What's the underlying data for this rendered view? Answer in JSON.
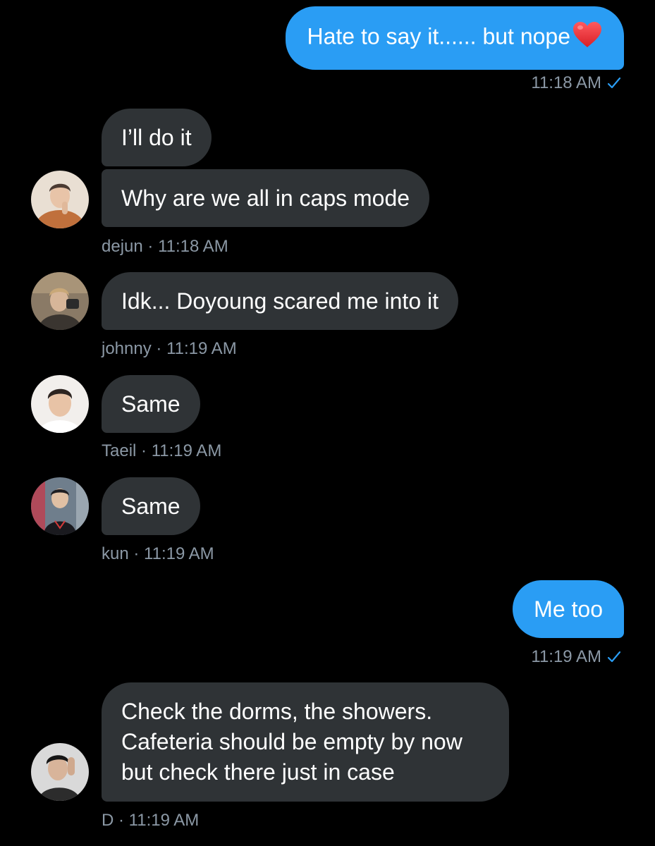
{
  "colors": {
    "background": "#000000",
    "outgoing_bubble": "#2a9df4",
    "incoming_bubble": "#2f3336",
    "meta_text": "#8b98a5",
    "read_check": "#2a9df4"
  },
  "messages": [
    {
      "direction": "outgoing",
      "text": "Hate to say it...... but nope",
      "emoji": "red-heart-icon",
      "time": "11:18 AM",
      "status_icon": "read-check-icon"
    },
    {
      "direction": "incoming",
      "text": "I’ll do it"
    },
    {
      "direction": "incoming",
      "text": "Why are we all in caps mode",
      "sender": "dejun",
      "time": "11:18 AM",
      "avatar": "dejun-avatar"
    },
    {
      "direction": "incoming",
      "text": "Idk... Doyoung scared me into it",
      "sender": "johnny",
      "time": "11:19 AM",
      "avatar": "johnny-avatar"
    },
    {
      "direction": "incoming",
      "text": "Same",
      "sender": "Taeil",
      "time": "11:19 AM",
      "avatar": "taeil-avatar"
    },
    {
      "direction": "incoming",
      "text": "Same",
      "sender": "kun",
      "time": "11:19 AM",
      "avatar": "kun-avatar"
    },
    {
      "direction": "outgoing",
      "text": "Me too",
      "time": "11:19 AM",
      "status_icon": "read-check-icon"
    },
    {
      "direction": "incoming",
      "text": "Check the dorms, the showers. Cafeteria should be empty by now but check there just in case",
      "sender": "D",
      "time": "11:19 AM",
      "avatar": "d-avatar"
    }
  ],
  "separator": " · "
}
